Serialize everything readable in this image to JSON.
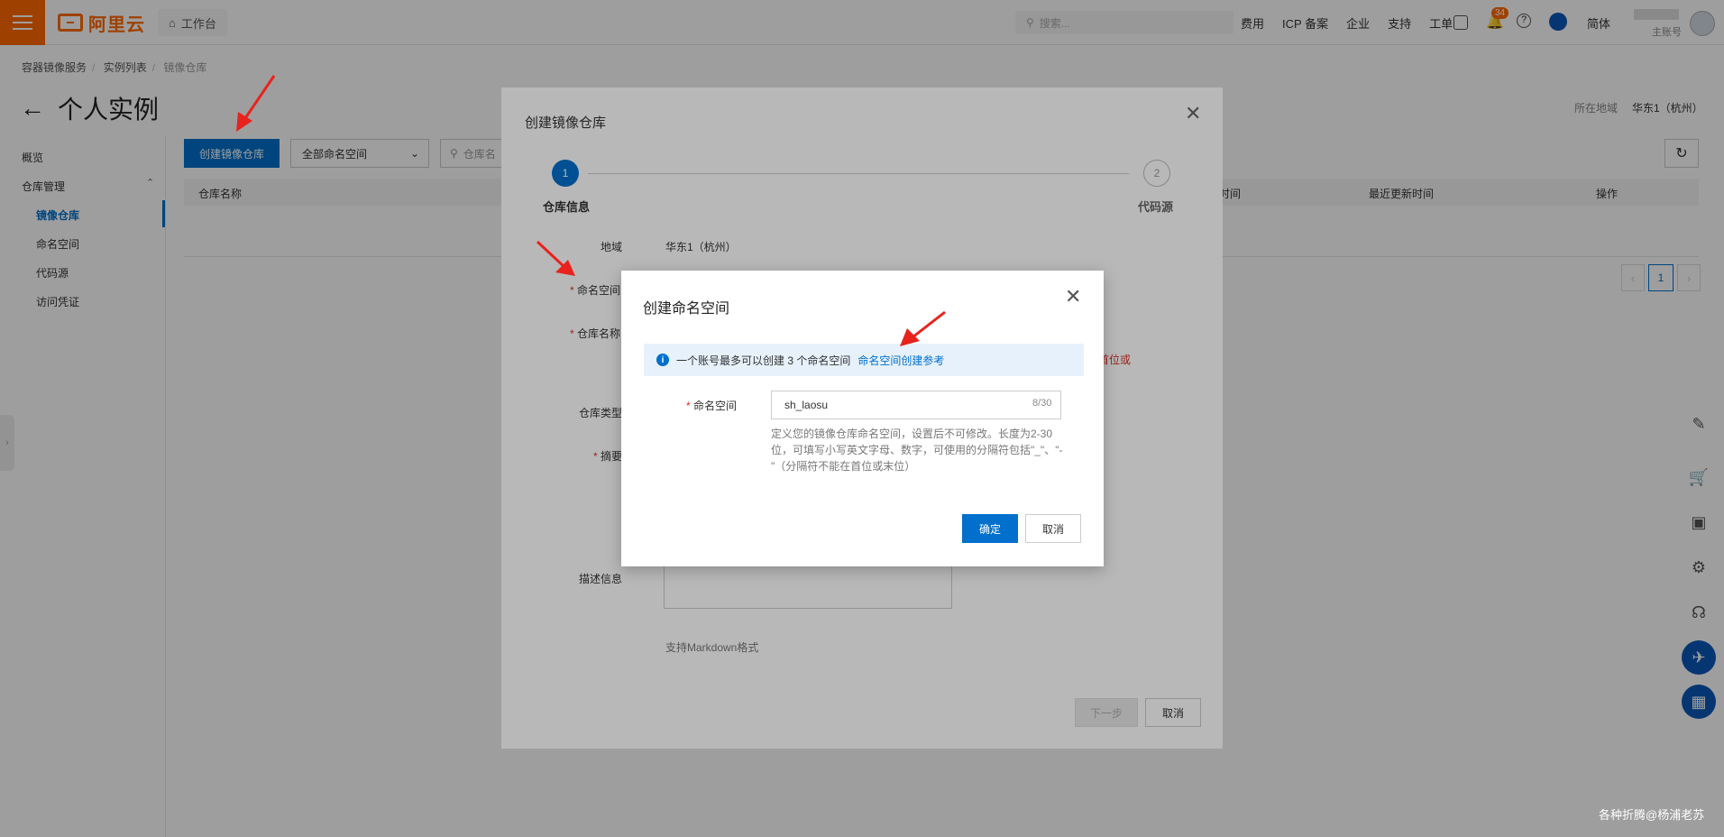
{
  "topbar": {
    "logo_text": "阿里云",
    "workbench": "工作台",
    "search_placeholder": "搜索...",
    "links": [
      "费用",
      "ICP 备案",
      "企业",
      "支持",
      "工单"
    ],
    "notification_count": "34",
    "language": "简体",
    "user_sub": "主账号"
  },
  "breadcrumb": [
    "容器镜像服务",
    "实例列表",
    "镜像仓库"
  ],
  "page_title": "个人实例",
  "region": {
    "label": "所在地域",
    "value": "华东1（杭州）"
  },
  "leftnav": {
    "overview": "概览",
    "repo_mgmt": "仓库管理",
    "items": [
      "镜像仓库",
      "命名空间",
      "代码源",
      "访问凭证"
    ]
  },
  "toolbar": {
    "create_repo": "创建镜像仓库",
    "ns_select": "全部命名空间",
    "search_placeholder": "仓库名"
  },
  "table": {
    "headers": [
      "仓库名称",
      "时间",
      "最近更新时间",
      "操作"
    ]
  },
  "pager": {
    "current": "1"
  },
  "dialog1": {
    "title": "创建镜像仓库",
    "step1_num": "1",
    "step1_label": "仓库信息",
    "step2_num": "2",
    "step2_label": "代码源",
    "region_label": "地域",
    "region_value": "华东1（杭州）",
    "namespace_label": "命名空间",
    "repo_name_label": "仓库名称",
    "repo_type_label": "仓库类型",
    "summary_label": "摘要",
    "desc_label": "描述信息",
    "markdown_hint": "支持Markdown格式",
    "error_fragment": "首位或",
    "next_button": "下一步",
    "cancel_button": "取消"
  },
  "dialog2": {
    "title": "创建命名空间",
    "info_text": "一个账号最多可以创建 3 个命名空间",
    "info_link": "命名空间创建参考",
    "ns_label": "命名空间",
    "ns_value": "sh_laosu",
    "ns_count": "8/30",
    "ns_help": "定义您的镜像仓库命名空间，设置后不可修改。长度为2-30位，可填写小写英文字母、数字，可使用的分隔符包括\"_\"、\"-\"（分隔符不能在首位或末位）",
    "ok_button": "确定",
    "cancel_button": "取消"
  },
  "watermark": "各种折腾@杨浦老苏",
  "colors": {
    "accent": "#0070cc",
    "brand": "#ff6a00",
    "arrow": "#e8231d"
  }
}
